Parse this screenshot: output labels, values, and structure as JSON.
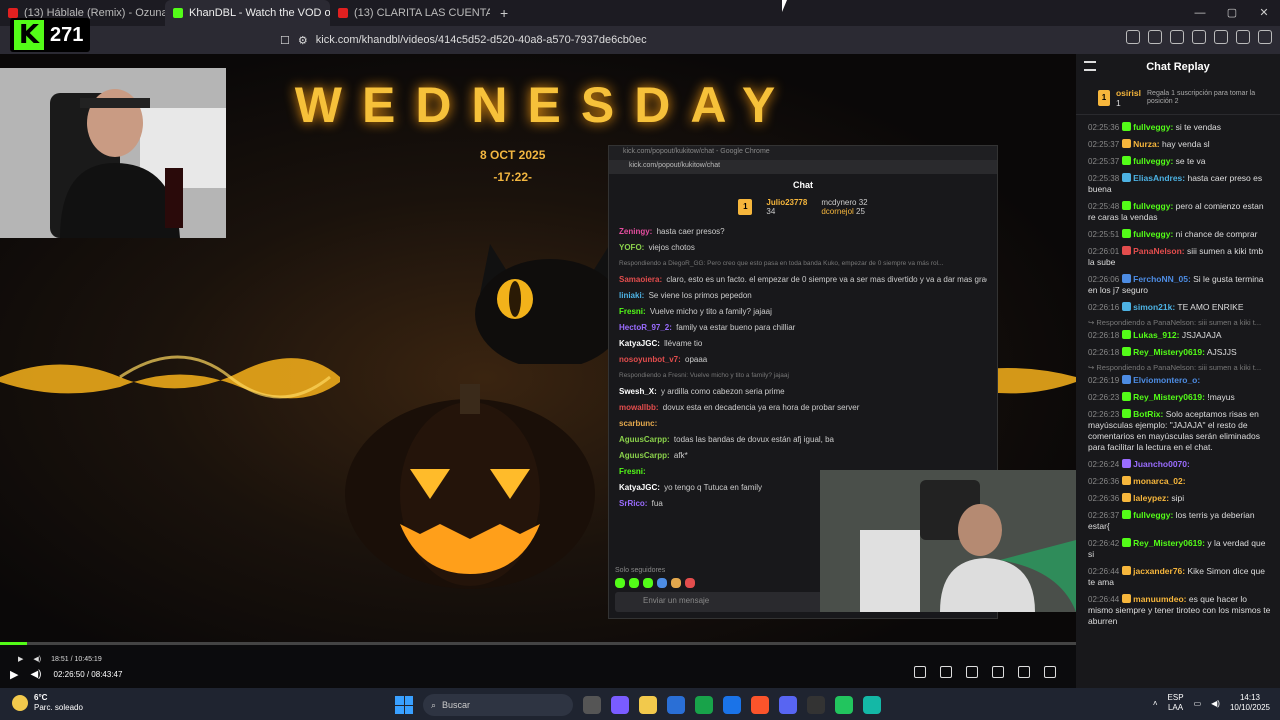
{
  "browser": {
    "tabs": [
      {
        "label": "(13) Háblale (Remix) - Ozuna, Bryant",
        "favicon": "#e02020",
        "active": false
      },
      {
        "label": "KhanDBL - Watch the VOD on K",
        "favicon": "#53fc18",
        "active": true
      },
      {
        "label": "(13) CLARITA LAS CUENTAS",
        "favicon": "#e02020",
        "active": false
      }
    ],
    "new_tab": "+",
    "url": "kick.com/khandbl/videos/414c5d52-d520-40a8-a570-7937de6cb0ec",
    "window_controls": [
      "—",
      "▢",
      "✕"
    ]
  },
  "stream": {
    "viewer_logo": "K",
    "viewer_count": "271",
    "title_text": "WEDNESDAY",
    "date_line1": "8  OCT  2025",
    "date_line2": "-17:22-"
  },
  "popout_chat": {
    "window_title": "kick.com/popout/kukitow/chat - Google Chrome",
    "url": "kick.com/popout/kukitow/chat",
    "chat_label": "Chat",
    "top_gifter": {
      "name": "Julio23778",
      "count": "34"
    },
    "top_others": [
      {
        "name": "mcdynero",
        "count": "32"
      },
      {
        "name": "dcornejol",
        "count": "25"
      }
    ],
    "messages": [
      {
        "user": "Zeningy",
        "color": "#e34d9e",
        "text": "hasta caer presos?"
      },
      {
        "user": "YOFO",
        "color": "#8ad14b",
        "text": "viejos chotos"
      },
      {
        "reply": "Respondiendo a DiegoR_GG: Pero creo que esto pasa en toda banda Kuko, empezar de 0 siempre va más rol..."
      },
      {
        "user": "Samaoiera",
        "color": "#e34d4d",
        "text": "claro, esto es un facto. el empezar de 0 siempre va a ser mas divertido y va a dar mas gracia... es como si hicieran un Wipe de Dovux"
      },
      {
        "user": "liniaki",
        "color": "#4db2e3",
        "text": "Se viene los primos pepedon"
      },
      {
        "user": "Fresni",
        "color": "#53fc18",
        "text": "Vuelve micho y tito a family? jajaaj"
      },
      {
        "user": "HectoR_97_2",
        "color": "#9a6cff",
        "text": "family va estar bueno para chilliar"
      },
      {
        "user": "KatyaJGC",
        "color": "#fff",
        "text": "llévame tio"
      },
      {
        "user": "nosoyunbot_v7",
        "color": "#e34d4d",
        "text": "opaaa"
      },
      {
        "reply": "Respondiendo a Fresni: Vuelve micho y tito a family? jajaaj"
      },
      {
        "user": "Swesh_X",
        "color": "#fff",
        "text": "y ardilla como cabezon seria prime"
      },
      {
        "user": "mowallbb",
        "color": "#e34d4d",
        "text": "dovux esta en decadencia ya era hora de probar server"
      },
      {
        "user": "scarbunc",
        "color": "#e3a84d",
        "text": ""
      },
      {
        "user": "AguusCarpp",
        "color": "#8ad14b",
        "text": "todas las bandas de dovux están afj igual, ba"
      },
      {
        "user": "AguusCarpp",
        "color": "#8ad14b",
        "text": "afk*"
      },
      {
        "user": "Fresni",
        "color": "#53fc18",
        "text": ""
      },
      {
        "user": "KatyaJGC",
        "color": "#fff",
        "text": "yo tengo q Tutuca en family"
      },
      {
        "user": "SrRico",
        "color": "#9a6cff",
        "text": "fua"
      }
    ],
    "followers_only": "Solo seguidores",
    "input_placeholder": "Enviar un mensaje"
  },
  "player": {
    "progress": 0.025,
    "inner_time": "18:51 / 10:45:19",
    "time": "02:26:50 / 08:43:47"
  },
  "replay": {
    "title": "Chat Replay",
    "top_user": "osirisl",
    "top_count": "1",
    "top_promo": "Regala 1 suscripción para tomar la posición 2",
    "messages": [
      {
        "time": "02:25:36",
        "user": "fullveggy",
        "color": "#53fc18",
        "text": "si te vendas"
      },
      {
        "time": "02:25:37",
        "user": "Nurza",
        "color": "#f6b63c",
        "text": "hay venda sl"
      },
      {
        "time": "02:25:37",
        "user": "fullveggy",
        "color": "#53fc18",
        "text": "se te va"
      },
      {
        "time": "02:25:38",
        "user": "EliasAndres",
        "color": "#4db2e3",
        "text": "hasta caer preso es buena"
      },
      {
        "time": "02:25:48",
        "user": "fullveggy",
        "color": "#53fc18",
        "text": "pero al comienzo estan re caras la vendas"
      },
      {
        "time": "02:25:51",
        "user": "fullveggy",
        "color": "#53fc18",
        "text": "ni chance de comprar"
      },
      {
        "time": "02:26:01",
        "user": "PanaNelson",
        "color": "#e34d4d",
        "text": "siii sumen a kiki tmb la sube"
      },
      {
        "time": "02:26:06",
        "user": "FerchoNN_05",
        "color": "#4d8ce3",
        "text": "Si le gusta termina en los j7 seguro"
      },
      {
        "time": "02:26:16",
        "user": "simon21k",
        "color": "#4db2e3",
        "text": "TE AMO ENRIKE"
      },
      {
        "reply": "Respondiendo a PanaNelson: siii sumen a kiki t..."
      },
      {
        "time": "02:26:18",
        "user": "Lukas_912",
        "color": "#53fc18",
        "text": "JSJAJAJA"
      },
      {
        "time": "02:26:18",
        "user": "Rey_Mistery0619",
        "color": "#53fc18",
        "text": "AJSJJS"
      },
      {
        "reply": "Respondiendo a PanaNelson: siii sumen a kiki t..."
      },
      {
        "time": "02:26:19",
        "user": "Elviomontero_o",
        "color": "#4d8ce3",
        "text": ""
      },
      {
        "time": "02:26:23",
        "user": "Rey_Mistery0619",
        "color": "#53fc18",
        "text": "!mayus"
      },
      {
        "time": "02:26:23",
        "user": "BotRix",
        "color": "#53fc18",
        "text": "Solo aceptamos risas en mayúsculas ejemplo: \"JAJAJA\" el resto de comentarios en mayúsculas serán eliminados para facilitar la lectura en el chat."
      },
      {
        "time": "02:26:24",
        "user": "Juancho0070",
        "color": "#9a6cff",
        "text": ""
      },
      {
        "time": "02:26:36",
        "user": "monarca_02",
        "color": "#f6b63c",
        "text": ""
      },
      {
        "time": "02:26:36",
        "user": "laleypez",
        "color": "#f6b63c",
        "text": "sipi"
      },
      {
        "time": "02:26:37",
        "user": "fullveggy",
        "color": "#53fc18",
        "text": "los terris ya deberian estar{"
      },
      {
        "time": "02:26:42",
        "user": "Rey_Mistery0619",
        "color": "#53fc18",
        "text": "y la verdad que si"
      },
      {
        "time": "02:26:44",
        "user": "jacxander76",
        "color": "#f6b63c",
        "text": "Kike Simon dice que te ama"
      },
      {
        "time": "02:26:44",
        "user": "manuumdeo",
        "color": "#f6b63c",
        "text": "es que hacer lo mismo siempre y tener tiroteo con los mismos te aburren"
      }
    ]
  },
  "taskbar": {
    "temp": "6°C",
    "weather": "Parc. soleado",
    "search_placeholder": "Buscar",
    "lang1": "ESP",
    "lang2": "LAA",
    "time": "14:13",
    "date": "10/10/2025"
  }
}
